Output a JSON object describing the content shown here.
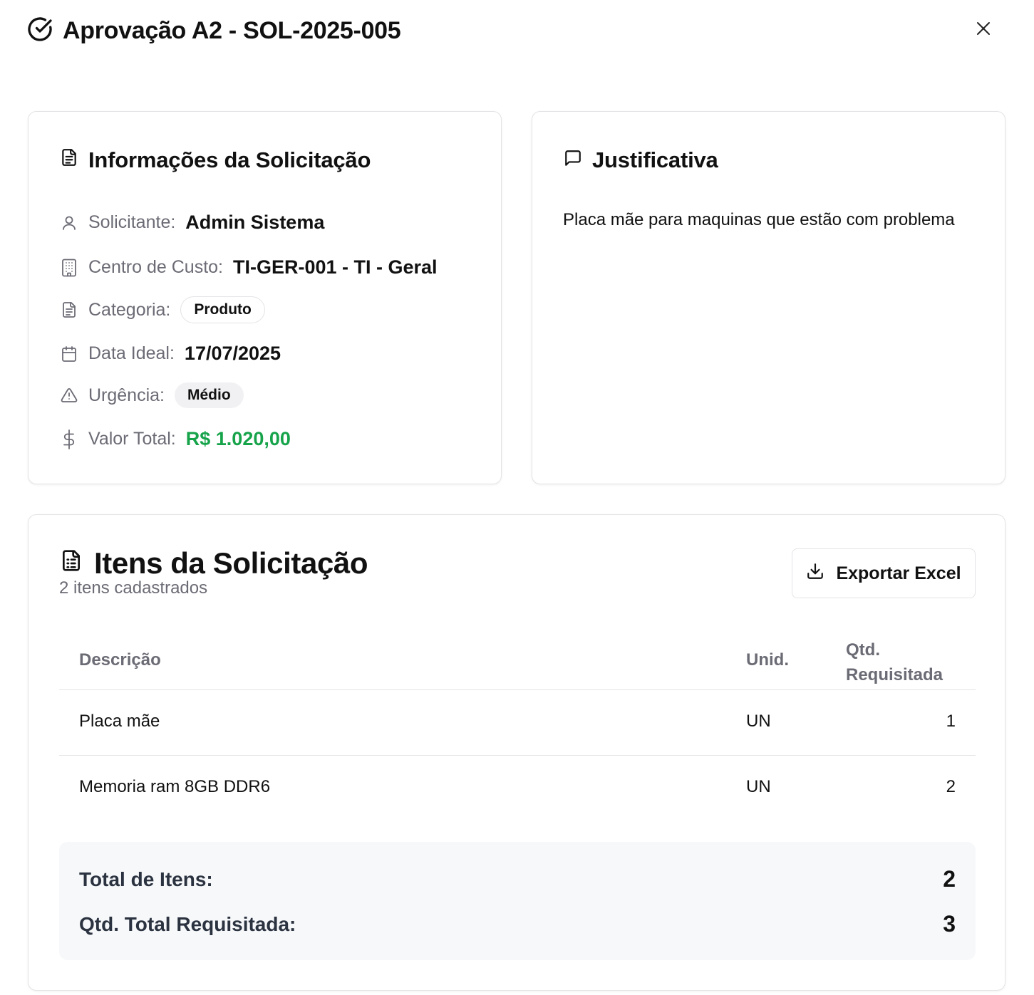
{
  "header": {
    "title": "Aprovação A2 - SOL-2025-005"
  },
  "info": {
    "title": "Informações da Solicitação",
    "requester_label": "Solicitante:",
    "requester_value": "Admin Sistema",
    "cost_center_label": "Centro de Custo:",
    "cost_center_value": "TI-GER-001 - TI - Geral",
    "category_label": "Categoria:",
    "category_value": "Produto",
    "date_label": "Data Ideal:",
    "date_value": "17/07/2025",
    "urgency_label": "Urgência:",
    "urgency_value": "Médio",
    "total_label": "Valor Total:",
    "total_value": "R$ 1.020,00"
  },
  "justification": {
    "title": "Justificativa",
    "text": "Placa mãe para maquinas que estão com problema"
  },
  "items": {
    "title": "Itens da Solicitação",
    "subtitle": "2 itens cadastrados",
    "export_label": "Exportar Excel",
    "columns": {
      "description": "Descrição",
      "unit": "Unid.",
      "qty": "Qtd. Requisitada"
    },
    "rows": [
      {
        "description": "Placa mãe",
        "unit": "UN",
        "qty": "1"
      },
      {
        "description": "Memoria ram 8GB DDR6",
        "unit": "UN",
        "qty": "2"
      }
    ],
    "totals": {
      "items_label": "Total de Itens:",
      "items_value": "2",
      "qty_label": "Qtd. Total Requisitada:",
      "qty_value": "3"
    }
  },
  "colors": {
    "accent_green": "#16a34a",
    "muted_text": "#6b6b75",
    "border": "#e4e4e7"
  }
}
